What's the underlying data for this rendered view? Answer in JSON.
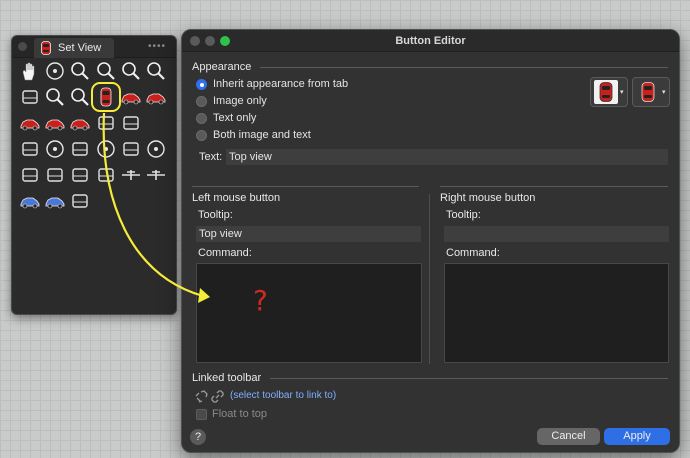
{
  "palette": {
    "tab_label": "Set View",
    "grip": "••••",
    "tools": [
      "pan-hand-icon",
      "orbit-icon",
      "zoom-icon",
      "zoom-window-icon",
      "zoom-selected-icon",
      "zoom-extents-icon",
      "undo-view-icon",
      "zoom-out-icon",
      "zoom-1to1-icon",
      "top-view-icon",
      "front-view-icon",
      "back-view-icon",
      "left-view-icon",
      "right-view-icon",
      "bottom-view-icon",
      "perspective-icon",
      "camera-icon",
      "",
      "plan-view-icon",
      "light-icon",
      "unfold-icon",
      "target-icon",
      "walk-icon",
      "compass-icon",
      "solar-panel-icon",
      "iso-view-icon",
      "elevation-icon",
      "section-icon",
      "aircraft-icon",
      "drone-icon",
      "car-side-icon",
      "car-front-icon",
      "explode-view-icon",
      "",
      "",
      ""
    ],
    "selected_index": 9
  },
  "editor": {
    "title": "Button Editor",
    "appearance_label": "Appearance",
    "radio_options": [
      "Inherit appearance from tab",
      "Image only",
      "Text only",
      "Both image and text"
    ],
    "selected_radio": 0,
    "text_label": "Text:",
    "text_value": "Top view",
    "caret": "▾",
    "left": {
      "header": "Left mouse button",
      "tooltip_label": "Tooltip:",
      "tooltip_value": "Top view",
      "command_label": "Command:",
      "command_value": "",
      "annotation": "?"
    },
    "right": {
      "header": "Right mouse button",
      "tooltip_label": "Tooltip:",
      "tooltip_value": "",
      "command_label": "Command:",
      "command_value": ""
    },
    "linked_label": "Linked toolbar",
    "link_prompt": "(select toolbar to link to)",
    "float_label": "Float to top",
    "help": "?",
    "cancel": "Cancel",
    "apply": "Apply"
  },
  "colors": {
    "accent": "#2f6fe6",
    "highlight": "#f5ec3a",
    "annotation": "#d02a1c",
    "car_red": "#c8201a"
  }
}
